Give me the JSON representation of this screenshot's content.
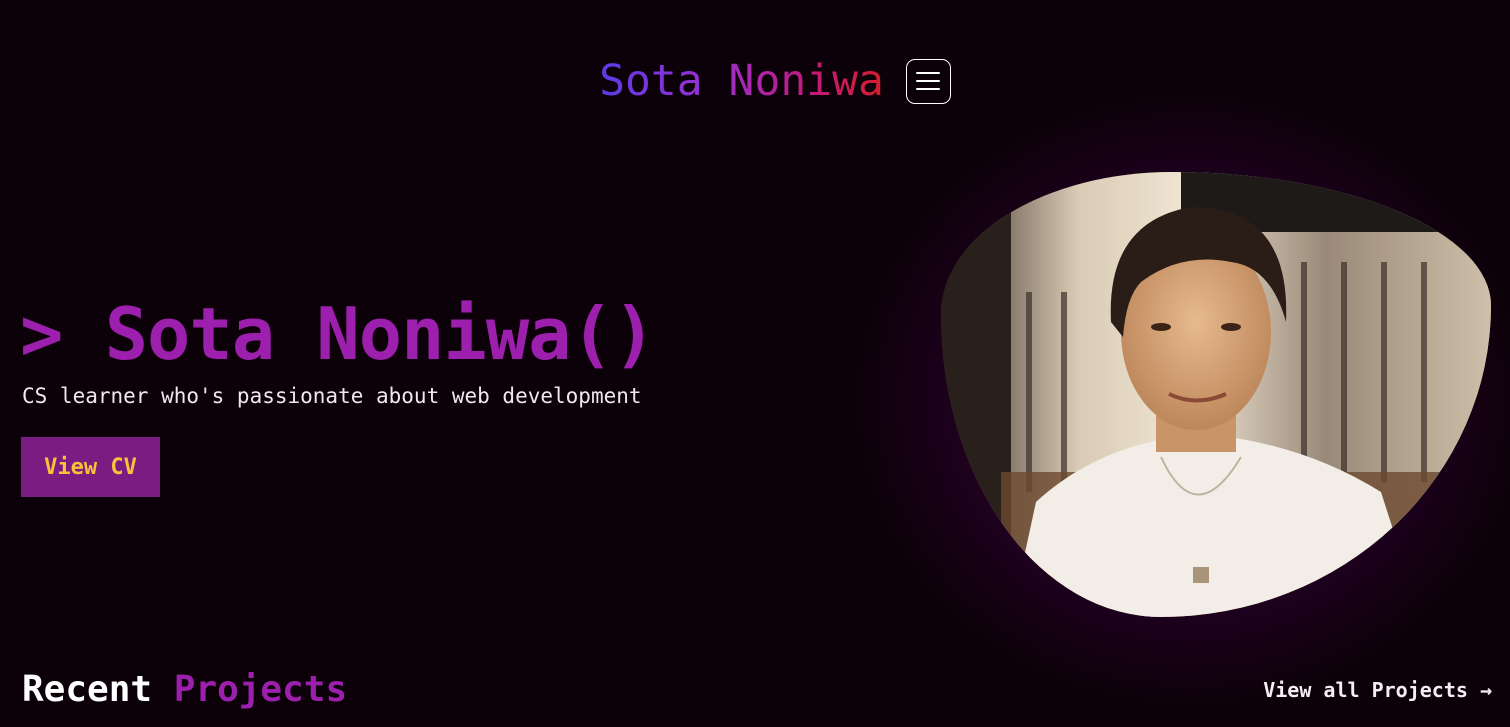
{
  "header": {
    "brand": "Sota Noniwa",
    "menu_icon": "hamburger-menu-icon"
  },
  "hero": {
    "title": "> Sota Noniwa()",
    "subtitle": "CS learner who's passionate about web development",
    "cv_button": "View CV",
    "photo_icon": "profile-photo"
  },
  "projects": {
    "heading_word1": "Recent",
    "heading_word2": "Projects",
    "view_all": "View all Projects →"
  },
  "colors": {
    "background": "#0c0108",
    "accent_purple": "#9d1fae",
    "button_bg": "#7a1c81",
    "button_text": "#f5c23a",
    "brand_gradient_start": "#5b3be6",
    "brand_gradient_end": "#d21f2a"
  }
}
